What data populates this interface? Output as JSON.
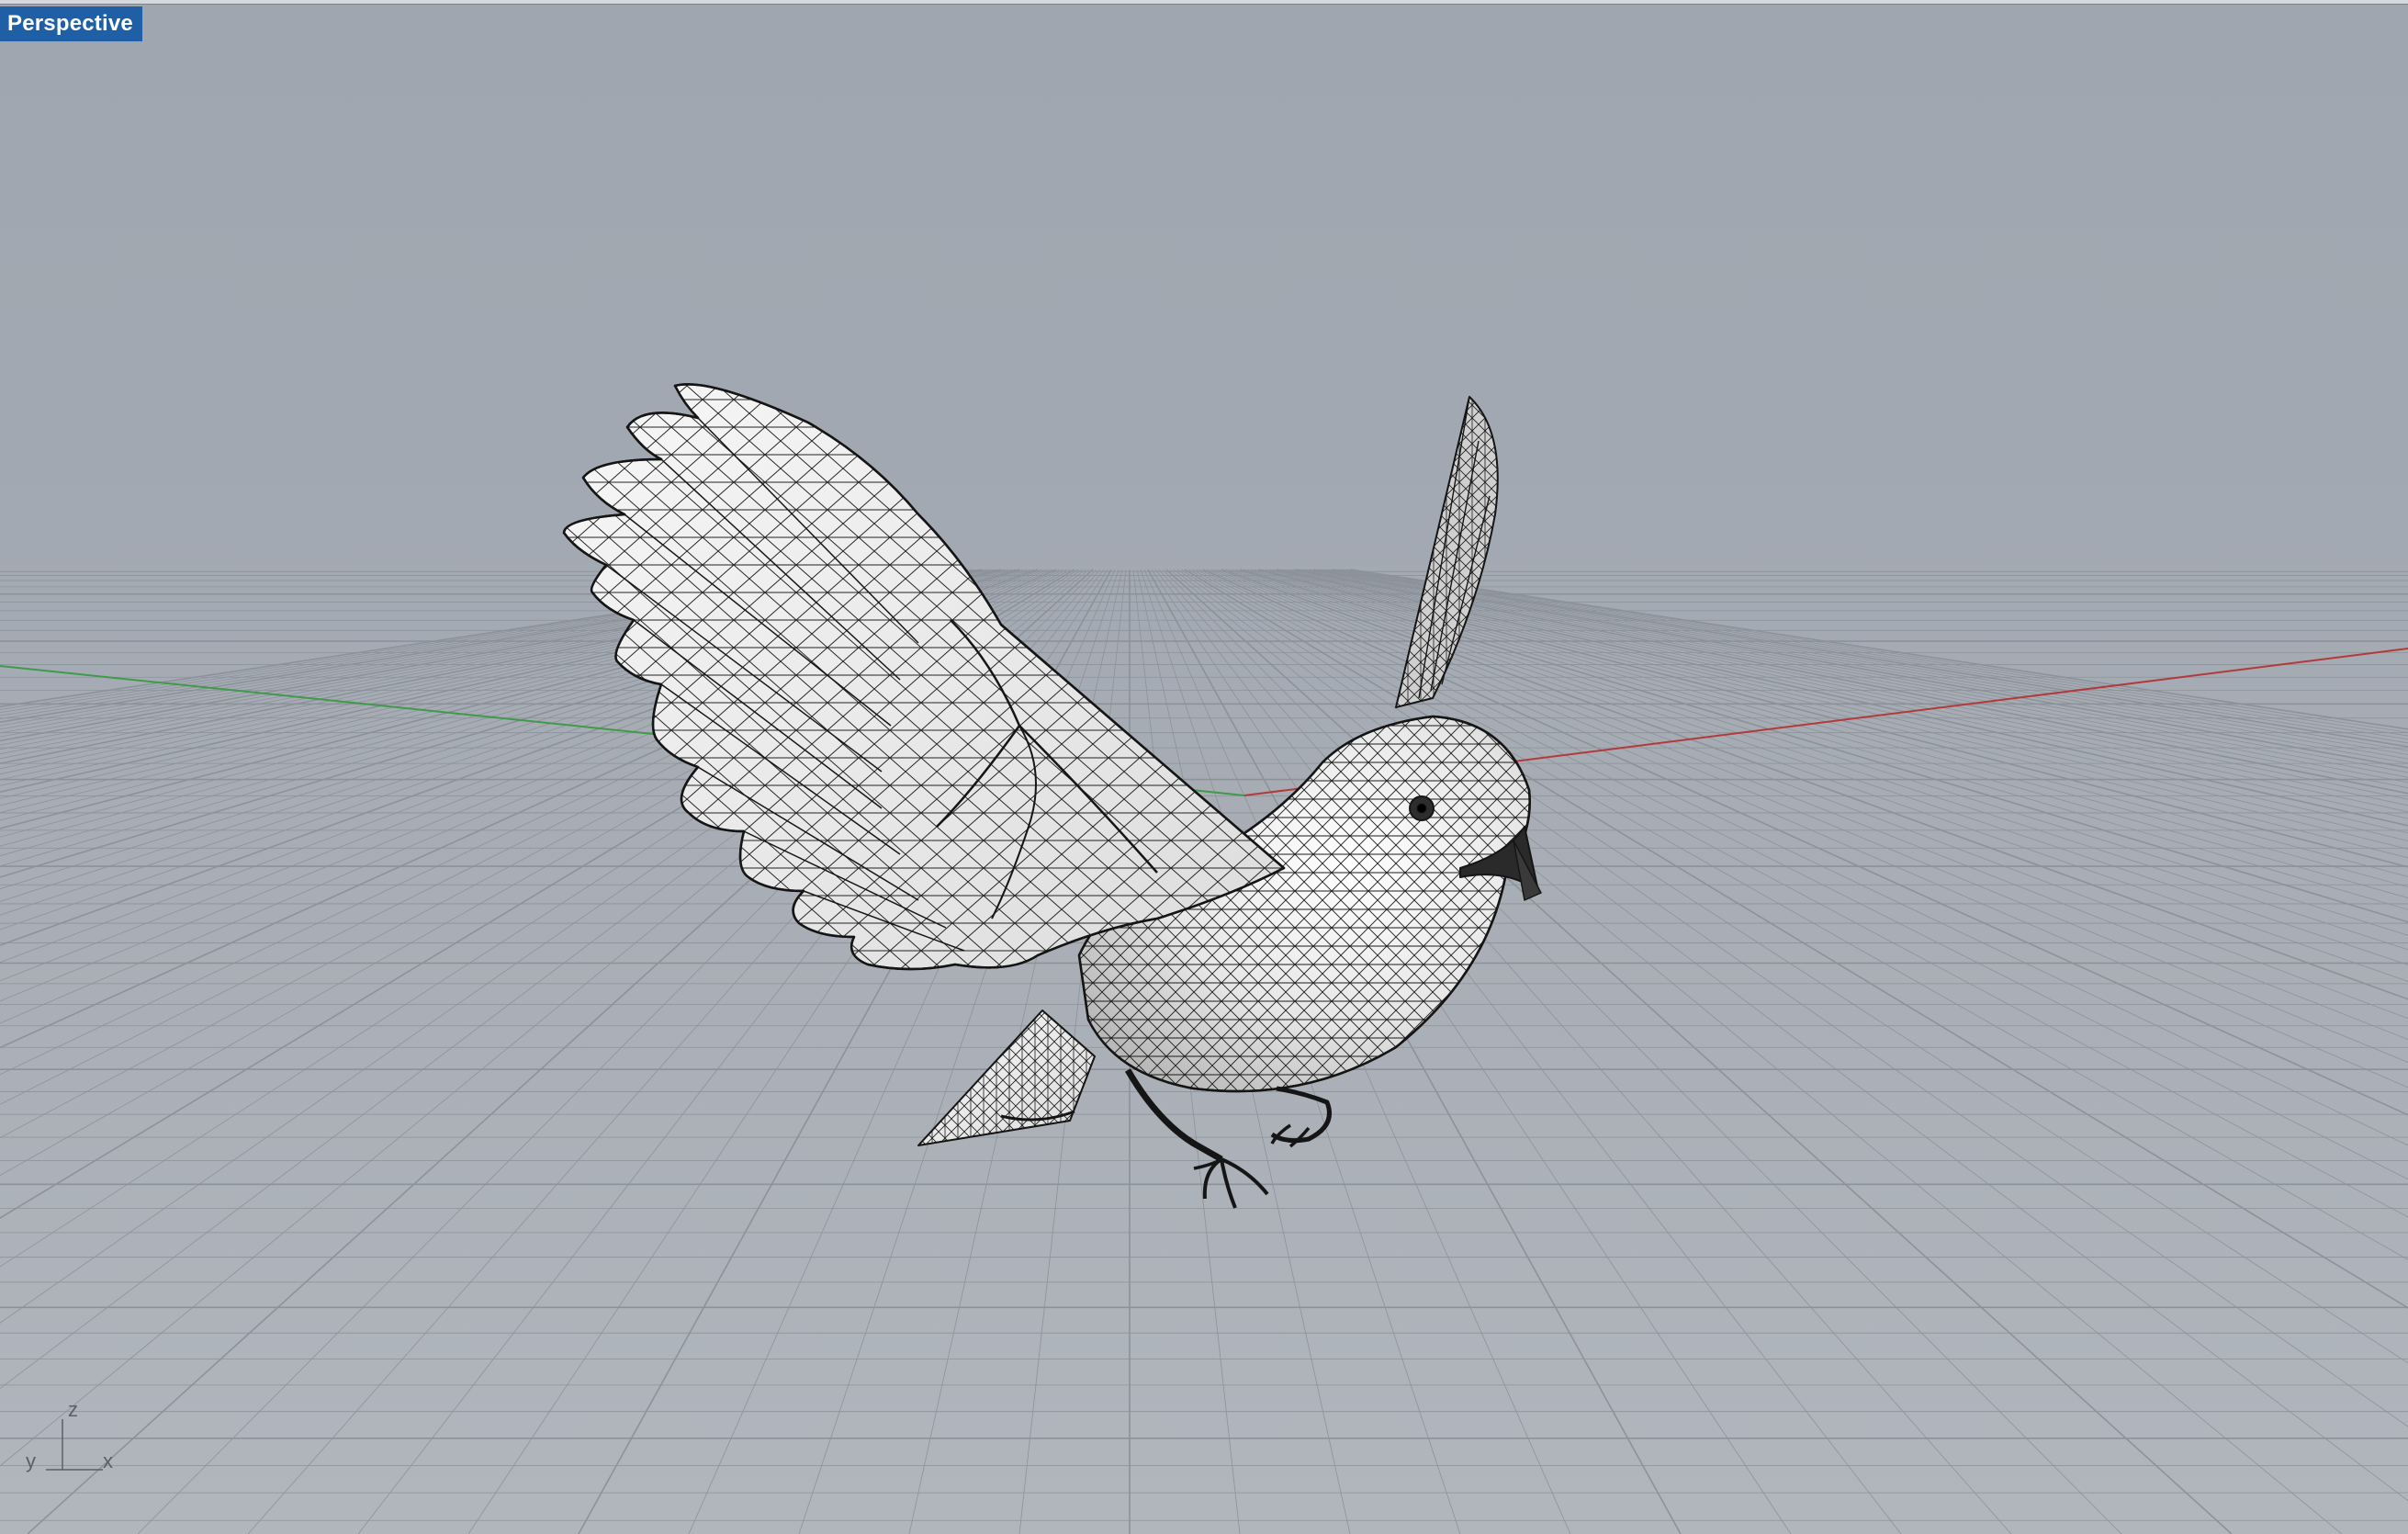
{
  "viewport": {
    "name": "Perspective",
    "background_color": "#a3a9b2",
    "grid_line_color": "#8c929a",
    "x_axis_color": "#b23a3a",
    "y_axis_color": "#3f9a4a"
  },
  "model": {
    "name": "bird",
    "display_mode": "wireframe",
    "wire_color": "#1a1a1a",
    "fill_color": "#efefef"
  },
  "axis_widget": {
    "z": "z",
    "y": "y",
    "x": "x"
  }
}
